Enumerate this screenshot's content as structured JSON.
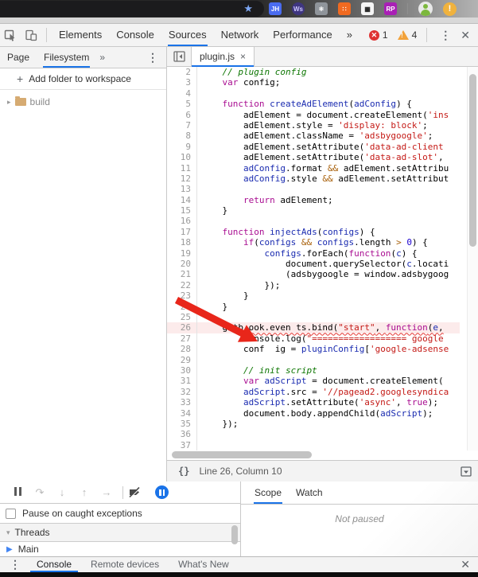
{
  "colors": {
    "accent": "#1a73e8",
    "error-badge": "#df3333",
    "warning-badge": "#f2a23a",
    "kw": "#a90d91",
    "str": "#c41a16",
    "com": "#0b7500",
    "ident": "#1a2bb0",
    "num": "#1c00cf",
    "op": "#a8600a",
    "errline": "#fcebeb",
    "wavyc": "#e53935",
    "arrow": "#e8261a",
    "pause-active": "#1a73e8"
  },
  "glyphs": {
    "star": "★",
    "overflow": "»",
    "kebab": "⋮",
    "close": "✕",
    "error_x": "✕",
    "warning_mark": "!",
    "plus": "+",
    "disclosure_closed": "▸",
    "disclosure_open": "▾",
    "tab_close": "×",
    "pretty_print": "{}",
    "step_over": "↷",
    "step_into": "↓",
    "step_out": "↑",
    "step": "→",
    "play": "▶",
    "alert": "!"
  },
  "topbar": {
    "extensions": [
      {
        "name": "jh",
        "text": "JH",
        "bg": "#4a6cf0",
        "fg": "#ffffff",
        "shape": "rounded"
      },
      {
        "name": "ws",
        "text": "Ws",
        "bg": "#3f3680",
        "fg": "#cfc9ff",
        "shape": "circle"
      },
      {
        "name": "react",
        "text": "⚛",
        "bg": "#8f949a",
        "fg": "#ffffff",
        "shape": "rounded"
      },
      {
        "name": "snippet",
        "text": "∷",
        "bg": "#f06a21",
        "fg": "#ffffff",
        "shape": "rounded"
      },
      {
        "name": "qr-code",
        "text": "▦",
        "bg": "#f5f5f5",
        "fg": "#1a1a1a",
        "shape": "rounded"
      },
      {
        "name": "rp",
        "text": "RP",
        "bg": "#a91fb5",
        "fg": "#ffffff",
        "shape": "rounded"
      }
    ],
    "alert_text": "!"
  },
  "devtools": {
    "tabs": [
      "Elements",
      "Console",
      "Sources",
      "Network",
      "Performance"
    ],
    "active_tab": "Sources",
    "error_count": "1",
    "warning_count": "4"
  },
  "navigator": {
    "tabs": [
      "Page",
      "Filesystem"
    ],
    "active_tab": "Filesystem",
    "add_folder_label": "Add folder to workspace",
    "tree": [
      {
        "label": "build"
      }
    ]
  },
  "editor": {
    "file_tab": "plugin.js",
    "status_position": "Line 26, Column 10",
    "lines": [
      {
        "n": 2,
        "t": [
          [
            "p",
            "    "
          ],
          [
            "c",
            "// plugin config"
          ]
        ]
      },
      {
        "n": 3,
        "t": [
          [
            "p",
            "    "
          ],
          [
            "k",
            "var"
          ],
          [
            "p",
            " config;"
          ]
        ]
      },
      {
        "n": 4,
        "t": []
      },
      {
        "n": 5,
        "t": [
          [
            "p",
            "    "
          ],
          [
            "k",
            "function"
          ],
          [
            "p",
            " "
          ],
          [
            "v",
            "createAdElement"
          ],
          [
            "p",
            "("
          ],
          [
            "v",
            "adConfig"
          ],
          [
            "p",
            ") {"
          ]
        ]
      },
      {
        "n": 6,
        "t": [
          [
            "p",
            "        adElement = document.createElement("
          ],
          [
            "s",
            "'ins"
          ]
        ]
      },
      {
        "n": 7,
        "t": [
          [
            "p",
            "        adElement.style = "
          ],
          [
            "s",
            "'display: block'"
          ],
          [
            "p",
            ";"
          ]
        ]
      },
      {
        "n": 8,
        "t": [
          [
            "p",
            "        adElement.className = "
          ],
          [
            "s",
            "'adsbygoogle'"
          ],
          [
            "p",
            ";"
          ]
        ]
      },
      {
        "n": 9,
        "t": [
          [
            "p",
            "        adElement.setAttribute("
          ],
          [
            "s",
            "'data-ad-client"
          ]
        ]
      },
      {
        "n": 10,
        "t": [
          [
            "p",
            "        adElement.setAttribute("
          ],
          [
            "s",
            "'data-ad-slot'"
          ],
          [
            "p",
            ","
          ]
        ]
      },
      {
        "n": 11,
        "t": [
          [
            "p",
            "        "
          ],
          [
            "v",
            "adConfig"
          ],
          [
            "p",
            ".format "
          ],
          [
            "o",
            "&&"
          ],
          [
            "p",
            " adElement.setAttribu"
          ]
        ]
      },
      {
        "n": 12,
        "t": [
          [
            "p",
            "        "
          ],
          [
            "v",
            "adConfig"
          ],
          [
            "p",
            ".style "
          ],
          [
            "o",
            "&&"
          ],
          [
            "p",
            " adElement.setAttribut"
          ]
        ]
      },
      {
        "n": 13,
        "t": []
      },
      {
        "n": 14,
        "t": [
          [
            "p",
            "        "
          ],
          [
            "k",
            "return"
          ],
          [
            "p",
            " adElement;"
          ]
        ]
      },
      {
        "n": 15,
        "t": [
          [
            "p",
            "    }"
          ]
        ]
      },
      {
        "n": 16,
        "t": []
      },
      {
        "n": 17,
        "t": [
          [
            "p",
            "    "
          ],
          [
            "k",
            "function"
          ],
          [
            "p",
            " "
          ],
          [
            "v",
            "injectAds"
          ],
          [
            "p",
            "("
          ],
          [
            "v",
            "configs"
          ],
          [
            "p",
            ") {"
          ]
        ]
      },
      {
        "n": 18,
        "t": [
          [
            "p",
            "        "
          ],
          [
            "k",
            "if"
          ],
          [
            "p",
            "("
          ],
          [
            "v",
            "configs"
          ],
          [
            "p",
            " "
          ],
          [
            "o",
            "&&"
          ],
          [
            "p",
            " "
          ],
          [
            "v",
            "configs"
          ],
          [
            "p",
            ".length "
          ],
          [
            "o",
            ">"
          ],
          [
            "p",
            " "
          ],
          [
            "n2",
            "0"
          ],
          [
            "p",
            ") {"
          ]
        ]
      },
      {
        "n": 19,
        "t": [
          [
            "p",
            "            "
          ],
          [
            "v",
            "configs"
          ],
          [
            "p",
            ".forEach("
          ],
          [
            "k",
            "function"
          ],
          [
            "p",
            "("
          ],
          [
            "v",
            "c"
          ],
          [
            "p",
            ") {"
          ]
        ]
      },
      {
        "n": 20,
        "t": [
          [
            "p",
            "                document.querySelector("
          ],
          [
            "v",
            "c"
          ],
          [
            "p",
            ".locati"
          ]
        ]
      },
      {
        "n": 21,
        "t": [
          [
            "p",
            "                (adsbygoogle = window.adsbygoog"
          ]
        ]
      },
      {
        "n": 22,
        "t": [
          [
            "p",
            "            });"
          ]
        ]
      },
      {
        "n": 23,
        "t": [
          [
            "p",
            "        }"
          ]
        ]
      },
      {
        "n": 24,
        "t": [
          [
            "p",
            "    }"
          ]
        ]
      },
      {
        "n": 25,
        "t": []
      },
      {
        "n": 26,
        "err": true,
        "t": [
          [
            "p",
            "    gitb "
          ],
          [
            "p",
            "ook.even ts.bind(",
            1
          ],
          [
            "s",
            "\"start\"",
            1
          ],
          [
            "p",
            ", ",
            1
          ],
          [
            "k",
            "function",
            1
          ],
          [
            "p",
            "(",
            1
          ],
          [
            "v",
            "e",
            1
          ],
          [
            "p",
            ",",
            1
          ]
        ]
      },
      {
        "n": 27,
        "t": [
          [
            "p",
            "        console.log("
          ],
          [
            "s",
            "\"================== google"
          ]
        ]
      },
      {
        "n": 28,
        "t": [
          [
            "p",
            "        conf  ig = "
          ],
          [
            "v",
            "pluginConfig"
          ],
          [
            "p",
            "["
          ],
          [
            "s",
            "'google-adsense"
          ]
        ]
      },
      {
        "n": 29,
        "t": []
      },
      {
        "n": 30,
        "t": [
          [
            "p",
            "        "
          ],
          [
            "c",
            "// init script"
          ]
        ]
      },
      {
        "n": 31,
        "t": [
          [
            "p",
            "        "
          ],
          [
            "k",
            "var"
          ],
          [
            "p",
            " "
          ],
          [
            "v",
            "adScript"
          ],
          [
            "p",
            " = document.createElement("
          ]
        ]
      },
      {
        "n": 32,
        "t": [
          [
            "p",
            "        "
          ],
          [
            "v",
            "adScript"
          ],
          [
            "p",
            ".src = "
          ],
          [
            "s",
            "'//pagead2.googlesyndica"
          ]
        ]
      },
      {
        "n": 33,
        "t": [
          [
            "p",
            "        "
          ],
          [
            "v",
            "adScript"
          ],
          [
            "p",
            ".setAttribute("
          ],
          [
            "s",
            "'async'"
          ],
          [
            "p",
            ", "
          ],
          [
            "k",
            "true"
          ],
          [
            "p",
            ");"
          ]
        ]
      },
      {
        "n": 34,
        "t": [
          [
            "p",
            "        document.body.appendChild("
          ],
          [
            "v",
            "adScript"
          ],
          [
            "p",
            ");"
          ]
        ]
      },
      {
        "n": 35,
        "t": [
          [
            "p",
            "    });"
          ]
        ]
      },
      {
        "n": 36,
        "t": []
      },
      {
        "n": 37,
        "t": []
      }
    ]
  },
  "debugger": {
    "pause_caught_label": "Pause on caught exceptions",
    "threads_label": "Threads",
    "threads": [
      "Main"
    ]
  },
  "scope_panel": {
    "tabs": [
      "Scope",
      "Watch"
    ],
    "active_tab": "Scope",
    "empty_message": "Not paused"
  },
  "drawer": {
    "tabs": [
      "Console",
      "Remote devices",
      "What's New"
    ],
    "active_tab": "Console"
  }
}
